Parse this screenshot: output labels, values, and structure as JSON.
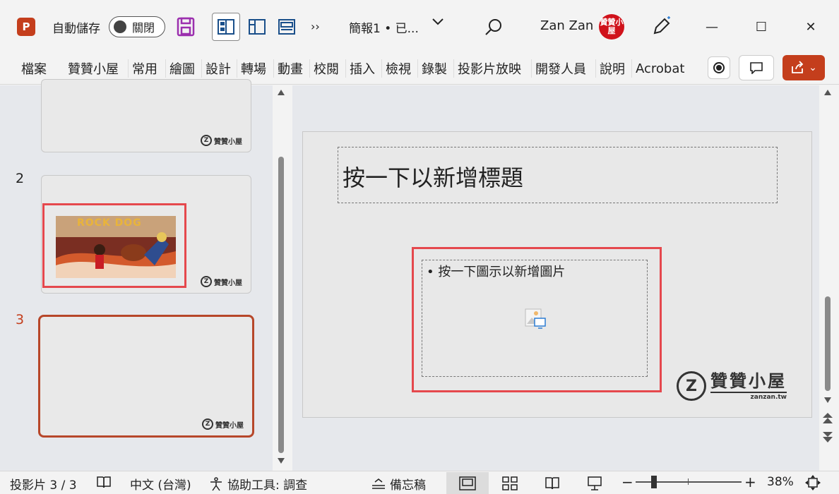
{
  "titlebar": {
    "app_logo": "P",
    "autosave_label": "自動儲存",
    "autosave_state": "關閉",
    "more_glyph": "››",
    "doc_title": "簡報1 • 已...",
    "user_name": "Zan Zan",
    "avatar_text": "贊贊小屋",
    "minimize": "—",
    "maximize": "☐",
    "close": "✕"
  },
  "ribbon": {
    "tabs": [
      "檔案",
      "贊贊小屋",
      "常用",
      "繪圖",
      "設計",
      "轉場",
      "動畫",
      "校閱",
      "插入",
      "檢視",
      "錄製",
      "投影片放映",
      "開發人員",
      "說明",
      "Acrobat"
    ],
    "share_chevron": "⌄"
  },
  "thumbnails": {
    "items": [
      {
        "number": "",
        "label": ""
      },
      {
        "number": "2",
        "label": "ROCK DOG"
      },
      {
        "number": "3",
        "label": ""
      }
    ],
    "logo_text": "贊贊小屋"
  },
  "slide": {
    "title_placeholder": "按一下以新增標題",
    "content_placeholder": "• 按一下圖示以新增圖片",
    "logo_z": "Z",
    "logo_brand": "贊贊小屋",
    "logo_domain": "zanzan.tw"
  },
  "statusbar": {
    "slide_count": "投影片 3 / 3",
    "language": "中文 (台灣)",
    "accessibility": "協助工具: 調查",
    "notes": "備忘稿",
    "zoom_minus": "−",
    "zoom_plus": "+",
    "zoom_level": "38%"
  },
  "colors": {
    "accent": "#c43e1c",
    "highlight_box": "#e5484d",
    "selected_thumb": "#b7472a"
  }
}
